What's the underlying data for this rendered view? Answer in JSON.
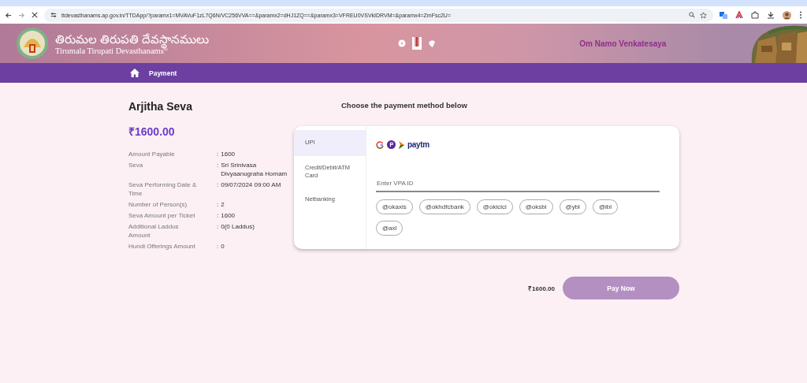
{
  "browser": {
    "url": "ttdevasthanams.ap.gov.in/TTDApp/?paramx1=MVAVuF1zL7Q6N/VC256VVA==&paramx2=dHJ1ZQ==&paramx3=VFREU0VSVkIDRVM=&paramx4=ZmFsc2U="
  },
  "header": {
    "title_telugu": "తిరుమల తిరుపతి దేవస్థానములు",
    "title_english": "Tirumala Tirupati Devasthanams",
    "title_mark": "®",
    "slogan": "Om Namo Venkatesaya"
  },
  "nav": {
    "items": [
      {
        "label": "Payment"
      }
    ]
  },
  "summary": {
    "title": "Arjitha Seva",
    "amount": "₹1600.00",
    "separator": ":",
    "rows": [
      {
        "label": "Amount Payable",
        "value": "1600"
      },
      {
        "label": "Seva",
        "value": "Sri Srinivasa Divyaanugraha Homam"
      },
      {
        "label": "Seva Performing Date & Time",
        "value": "09/07/2024 09:00 AM"
      },
      {
        "label": "Number of Person(s)",
        "value": "2"
      },
      {
        "label": "Seva Amount per Ticket",
        "value": "1600"
      },
      {
        "label": "Additional Laddus Amount",
        "value": "0(0 Laddus)"
      },
      {
        "label": "Hundi Offerings Amount",
        "value": "0"
      }
    ]
  },
  "payment": {
    "heading": "Choose the payment method below",
    "methods": [
      {
        "label": "UPI",
        "selected": true
      },
      {
        "label": "Credit/Debit/ATM Card",
        "selected": false
      },
      {
        "label": "Netbanking",
        "selected": false
      }
    ],
    "wallet_logo_text": "paytm",
    "vpa_field": {
      "placeholder": "Enter VPA ID"
    },
    "handles": [
      "@okaxis",
      "@okhdfcbank",
      "@okicici",
      "@oksbi",
      "@ybl",
      "@ibl",
      "@axl"
    ],
    "total": "₹1600.00",
    "pay_button": {
      "label": "Pay Now",
      "disabled": true
    }
  }
}
